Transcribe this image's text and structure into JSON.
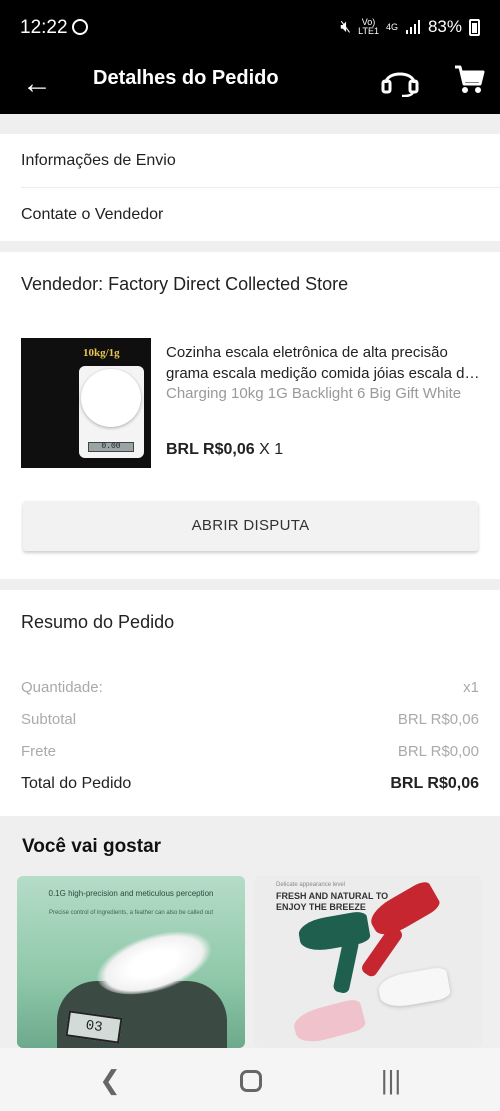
{
  "status_bar": {
    "time": "12:22",
    "network_top": "Vo)",
    "network_bottom": "LTE1",
    "signal_label": "4G",
    "battery": "83%"
  },
  "app_bar": {
    "title": "Detalhes do Pedido"
  },
  "links": {
    "shipping_info": "Informações de Envio",
    "contact_seller": "Contate o Vendedor"
  },
  "seller": {
    "label": "Vendedor: Factory Direct Collected Store"
  },
  "product": {
    "image_badge": "10kg/1g",
    "image_display": "0.00",
    "name_line1": "Cozinha escala eletrônica de alta precisão",
    "name_line2": "grama escala medição comida jóias escala digital",
    "variant": "Charging 10kg 1G Backlight   6 Big Gift White",
    "price": "BRL R$0,06",
    "quantity": " X 1"
  },
  "dispute_button": {
    "label": "ABRIR DISPUTA"
  },
  "summary": {
    "title": "Resumo do Pedido",
    "rows": [
      {
        "label": "Quantidade:",
        "value": "x1"
      },
      {
        "label": "Subtotal",
        "value": "BRL R$0,06"
      },
      {
        "label": "Frete",
        "value": "BRL R$0,00"
      }
    ],
    "total": {
      "label": "Total do Pedido",
      "value": "BRL R$0,06"
    }
  },
  "recommendations": {
    "title": "Você vai gostar",
    "items": [
      {
        "caption": "0.1G high-precision and meticulous perception",
        "subcaption": "Precise control of ingredients, a feather can also be called out",
        "display": "03"
      },
      {
        "tag": "Delicate appearance level",
        "headline": "FRESH AND NATURAL TO ENJOY THE BREEZE"
      }
    ]
  },
  "colors": {
    "app_bar": "#000000",
    "background": "#efefef",
    "card": "#ffffff",
    "muted_text": "#aaaaaa"
  },
  "icons": [
    "back-arrow-icon",
    "support-headset-icon",
    "shopping-cart-icon",
    "whatsapp-icon",
    "mute-icon",
    "battery-icon",
    "nav-back-icon",
    "nav-home-icon",
    "nav-recents-icon"
  ]
}
